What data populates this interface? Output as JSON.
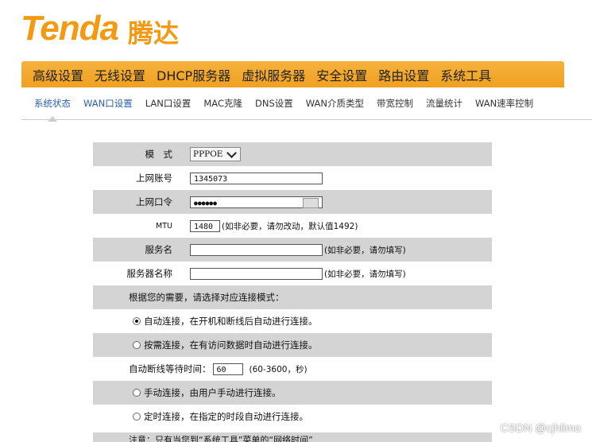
{
  "brand": {
    "name_en": "Tenda",
    "name_cn": "腾达"
  },
  "topnav": [
    "高级设置",
    "无线设置",
    "DHCP服务器",
    "虚拟服务器",
    "安全设置",
    "路由设置",
    "系统工具"
  ],
  "subnav": [
    "系统状态",
    "WAN口设置",
    "LAN口设置",
    "MAC克隆",
    "DNS设置",
    "WAN介质类型",
    "带宽控制",
    "流量统计",
    "WAN速率控制"
  ],
  "form": {
    "mode_label": "模　式",
    "mode_value": "PPPOE",
    "account_label": "上网账号",
    "account_value": "1345073",
    "password_label": "上网口令",
    "password_value": "●●●●●●",
    "mtu_label": "MTU",
    "mtu_value": "1480",
    "mtu_hint": "(如非必要，请勿改动，默认值1492)",
    "service_label": "服务名",
    "service_hint": "(如非必要，请勿填写)",
    "server_label": "服务器名称",
    "server_hint": "(如非必要，请勿填写)",
    "connect_prompt": "根据您的需要，请选择对应连接模式：",
    "opt_auto": "自动连接，在开机和断线后自动进行连接。",
    "opt_demand": "按需连接，在有访问数据时自动进行连接。",
    "idle_label": "自动断线等待时间：",
    "idle_value": "60",
    "idle_hint": "(60-3600，秒)",
    "opt_manual": "手动连接，由用户手动进行连接。",
    "opt_timed": "定时连接，在指定的时段自动进行连接。",
    "note_cut": "注意：只有当您到“系统工具”菜单的“网络时间”"
  },
  "watermark": "CSDN @cjhlimo"
}
